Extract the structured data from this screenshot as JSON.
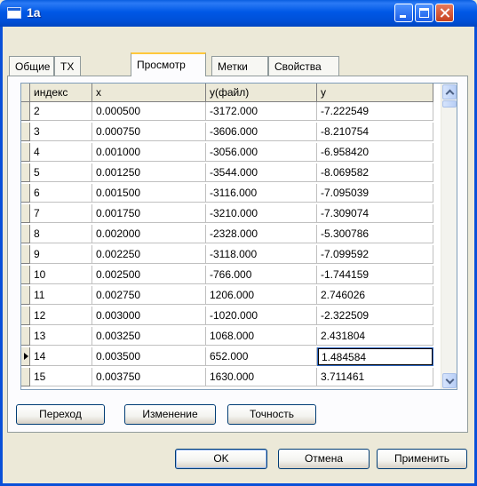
{
  "window": {
    "title": "1a"
  },
  "tabs": [
    "Общие",
    "TX",
    "Просмотр",
    "Метки",
    "Свойства"
  ],
  "active_tab": "Просмотр",
  "grid": {
    "columns": [
      "индекс",
      "x",
      "y(файл)",
      "y"
    ],
    "rows": [
      [
        "2",
        "0.000500",
        "-3172.000",
        "-7.222549"
      ],
      [
        "3",
        "0.000750",
        "-3606.000",
        "-8.210754"
      ],
      [
        "4",
        "0.001000",
        "-3056.000",
        "-6.958420"
      ],
      [
        "5",
        "0.001250",
        "-3544.000",
        "-8.069582"
      ],
      [
        "6",
        "0.001500",
        "-3116.000",
        "-7.095039"
      ],
      [
        "7",
        "0.001750",
        "-3210.000",
        "-7.309074"
      ],
      [
        "8",
        "0.002000",
        "-2328.000",
        "-5.300786"
      ],
      [
        "9",
        "0.002250",
        "-3118.000",
        "-7.099592"
      ],
      [
        "10",
        "0.002500",
        "-766.000",
        "-1.744159"
      ],
      [
        "11",
        "0.002750",
        "1206.000",
        "2.746026"
      ],
      [
        "12",
        "0.003000",
        "-1020.000",
        "-2.322509"
      ],
      [
        "13",
        "0.003250",
        "1068.000",
        "2.431804"
      ],
      [
        "14",
        "0.003500",
        "652.000",
        "1.484584"
      ],
      [
        "15",
        "0.003750",
        "1630.000",
        "3.711461"
      ]
    ],
    "current_row_index": "14"
  },
  "actions": {
    "goto": "Переход",
    "change": "Изменение",
    "precision": "Точность"
  },
  "dialog": {
    "ok": "OK",
    "cancel": "Отмена",
    "apply": "Применить"
  }
}
